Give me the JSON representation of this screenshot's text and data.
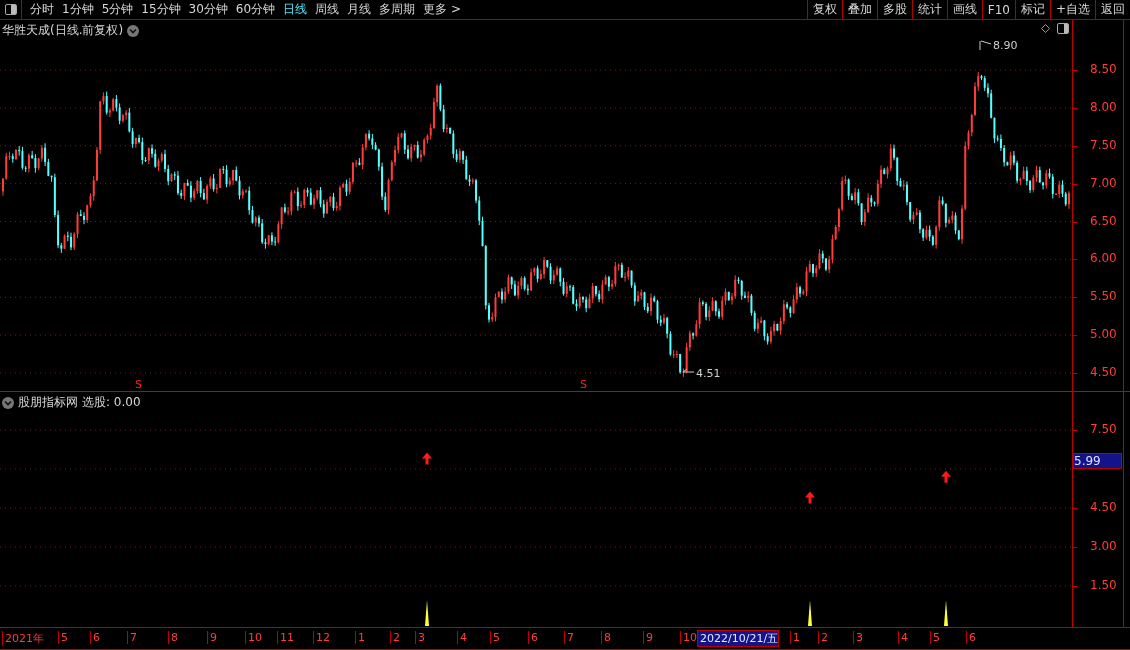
{
  "toolbar": {
    "periods": [
      {
        "label": "分时",
        "selected": false
      },
      {
        "label": "1分钟",
        "selected": false
      },
      {
        "label": "5分钟",
        "selected": false
      },
      {
        "label": "15分钟",
        "selected": false
      },
      {
        "label": "30分钟",
        "selected": false
      },
      {
        "label": "60分钟",
        "selected": false
      },
      {
        "label": "日线",
        "selected": true
      },
      {
        "label": "周线",
        "selected": false
      },
      {
        "label": "月线",
        "selected": false
      },
      {
        "label": "多周期",
        "selected": false
      },
      {
        "label": "更多 >",
        "selected": false
      }
    ],
    "actions": [
      "复权",
      "叠加",
      "多股",
      "统计",
      "画线",
      "F10",
      "标记",
      "+自选",
      "返回"
    ]
  },
  "chart": {
    "title": "华胜天成(日线.前复权)",
    "price_axis": [
      "8.50",
      "8.00",
      "7.50",
      "7.00",
      "6.50",
      "6.00",
      "5.50",
      "5.00",
      "4.50"
    ],
    "high_marker": "8.90",
    "low_marker": "4.51",
    "signals": [
      "S",
      "S"
    ]
  },
  "indicator": {
    "name": "股朋指标网",
    "reading": "选股: 0.00",
    "axis": [
      "7.50",
      "4.50",
      "3.00",
      "1.50"
    ],
    "cursor_value": "5.99"
  },
  "time_axis": [
    {
      "label": "2021年",
      "kind": "tick"
    },
    {
      "label": "5",
      "kind": "tick"
    },
    {
      "label": "6",
      "kind": "tick"
    },
    {
      "label": "7",
      "kind": "tick"
    },
    {
      "label": "8",
      "kind": "tick"
    },
    {
      "label": "9",
      "kind": "tick"
    },
    {
      "label": "10",
      "kind": "tick"
    },
    {
      "label": "11",
      "kind": "tick"
    },
    {
      "label": "12",
      "kind": "tick"
    },
    {
      "label": "1",
      "kind": "tick"
    },
    {
      "label": "2",
      "kind": "tick"
    },
    {
      "label": "3",
      "kind": "tick"
    },
    {
      "label": "4",
      "kind": "tick"
    },
    {
      "label": "5",
      "kind": "tick"
    },
    {
      "label": "6",
      "kind": "tick"
    },
    {
      "label": "7",
      "kind": "tick"
    },
    {
      "label": "8",
      "kind": "tick"
    },
    {
      "label": "9",
      "kind": "tick"
    },
    {
      "label": "10",
      "kind": "tick"
    },
    {
      "label": "2022/10/21/五",
      "kind": "cursor"
    },
    {
      "label": "1",
      "kind": "tick"
    },
    {
      "label": "2",
      "kind": "tick"
    },
    {
      "label": "3",
      "kind": "tick"
    },
    {
      "label": "4",
      "kind": "tick"
    },
    {
      "label": "5",
      "kind": "tick"
    },
    {
      "label": "6",
      "kind": "tick"
    }
  ]
}
